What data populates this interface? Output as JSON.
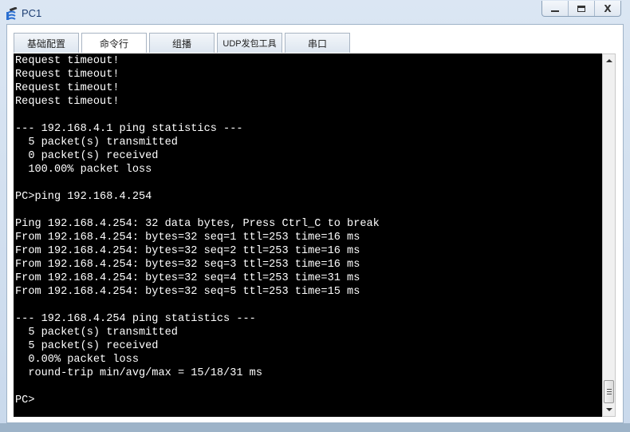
{
  "window": {
    "title": "PC1",
    "icon": "network-pc-icon",
    "controls": {
      "minimize": "minimize-icon",
      "maximize": "maximize-icon",
      "close_label": "X"
    }
  },
  "tabs": [
    {
      "label": "基础配置",
      "active": false
    },
    {
      "label": "命令行",
      "active": true
    },
    {
      "label": "组播",
      "active": false
    },
    {
      "label": "UDP发包工具",
      "active": false
    },
    {
      "label": "串口",
      "active": false
    }
  ],
  "terminal": {
    "lines": [
      "Request timeout!",
      "Request timeout!",
      "Request timeout!",
      "Request timeout!",
      "",
      "--- 192.168.4.1 ping statistics ---",
      "  5 packet(s) transmitted",
      "  0 packet(s) received",
      "  100.00% packet loss",
      "",
      "PC>ping 192.168.4.254",
      "",
      "Ping 192.168.4.254: 32 data bytes, Press Ctrl_C to break",
      "From 192.168.4.254: bytes=32 seq=1 ttl=253 time=16 ms",
      "From 192.168.4.254: bytes=32 seq=2 ttl=253 time=16 ms",
      "From 192.168.4.254: bytes=32 seq=3 ttl=253 time=16 ms",
      "From 192.168.4.254: bytes=32 seq=4 ttl=253 time=31 ms",
      "From 192.168.4.254: bytes=32 seq=5 ttl=253 time=15 ms",
      "",
      "--- 192.168.4.254 ping statistics ---",
      "  5 packet(s) transmitted",
      "  5 packet(s) received",
      "  0.00% packet loss",
      "  round-trip min/avg/max = 15/18/31 ms",
      "",
      "PC>"
    ]
  },
  "scrollbar": {
    "position_percent": 100
  }
}
